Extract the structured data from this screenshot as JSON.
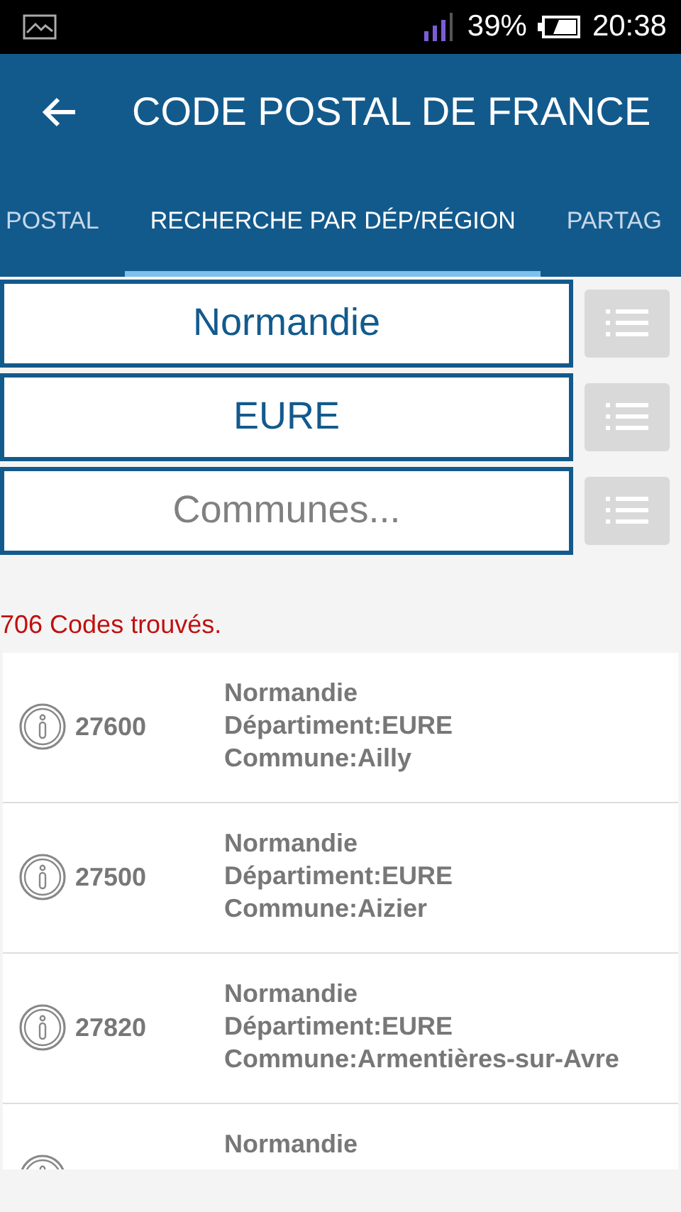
{
  "status_bar": {
    "battery": "39%",
    "time": "20:38"
  },
  "app_bar": {
    "title": "CODE POSTAL DE FRANCE"
  },
  "tabs": [
    {
      "label": "POSTAL",
      "selected": false
    },
    {
      "label": "RECHERCHE PAR DÉP/RÉGION",
      "selected": true
    },
    {
      "label": "PARTAG",
      "selected": false
    }
  ],
  "selectors": [
    {
      "value": "Normandie"
    },
    {
      "value": "EURE"
    },
    {
      "placeholder": "Communes..."
    }
  ],
  "result_count": "706 Codes trouvés.",
  "results": [
    {
      "code": "27600",
      "region": "Normandie",
      "department": "Départiment:EURE",
      "commune": "Commune:Ailly"
    },
    {
      "code": "27500",
      "region": "Normandie",
      "department": "Départiment:EURE",
      "commune": "Commune:Aizier"
    },
    {
      "code": "27820",
      "region": "Normandie",
      "department": "Départiment:EURE",
      "commune": "Commune:Armentières-sur-Avre"
    },
    {
      "region": "Normandie"
    }
  ]
}
